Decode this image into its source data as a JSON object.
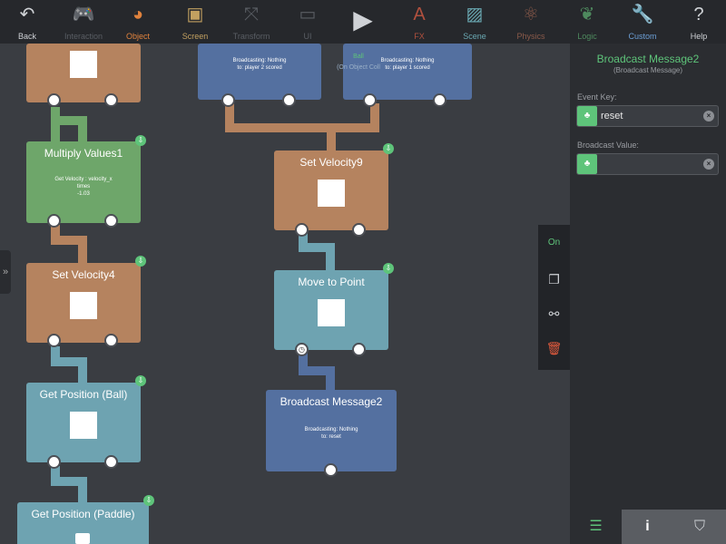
{
  "toolbar": {
    "items": [
      {
        "label": "Back",
        "icon": "back-arrow-icon",
        "glyph": "↶",
        "color": "#cfd2d6"
      },
      {
        "label": "Interaction",
        "icon": "gamepad-icon",
        "glyph": "🎮",
        "color": "#5a5e64"
      },
      {
        "label": "Object",
        "icon": "pacman-icon",
        "glyph": "◕",
        "color": "#e0823d"
      },
      {
        "label": "Screen",
        "icon": "screen-icon",
        "glyph": "▣",
        "color": "#c2a060"
      },
      {
        "label": "Transform",
        "icon": "transform-arrows-icon",
        "glyph": "⤧",
        "color": "#5a5e64"
      },
      {
        "label": "UI",
        "icon": "speech-bubble-icon",
        "glyph": "▭",
        "color": "#5a5e64"
      },
      {
        "label": "",
        "icon": "play-icon",
        "glyph": "▶",
        "color": "#cfd2d6"
      },
      {
        "label": "FX",
        "icon": "fx-icon",
        "glyph": "A",
        "color": "#b0503e"
      },
      {
        "label": "Scene",
        "icon": "scene-image-icon",
        "glyph": "▨",
        "color": "#6aa8b2"
      },
      {
        "label": "Physics",
        "icon": "atom-icon",
        "glyph": "⚛",
        "color": "#8b5a4a"
      },
      {
        "label": "Logic",
        "icon": "brain-icon",
        "glyph": "❦",
        "color": "#4e8a5e"
      },
      {
        "label": "Custom",
        "icon": "wrench-icon",
        "glyph": "🔧",
        "color": "#6c9fd6"
      },
      {
        "label": "Help",
        "icon": "help-icon",
        "glyph": "?",
        "color": "#cfd2d6"
      }
    ]
  },
  "nodes": {
    "top_left": {
      "title": ""
    },
    "multiply": {
      "title": "Multiply Values1",
      "body": [
        "Get Velocity : velocity_x",
        "times",
        "-1.03"
      ]
    },
    "set_velocity4": {
      "title": "Set Velocity4"
    },
    "get_position_ball": {
      "title": "Get Position (Ball)"
    },
    "get_position_paddle": {
      "title": "Get Position (Paddle)"
    },
    "broadcast_a": {
      "body": [
        "Broadcasting: Nothing",
        "to: player 2 scored"
      ]
    },
    "broadcast_b": {
      "body": [
        "Broadcasting: Nothing",
        "to: player 1 scored"
      ]
    },
    "overlay_ball": {
      "title": "Ball",
      "sub": "(On Object Coll"
    },
    "set_velocity9": {
      "title": "Set Velocity9"
    },
    "move_to_point": {
      "title": "Move to Point"
    },
    "broadcast_message2": {
      "title": "Broadcast Message2",
      "body": [
        "Broadcasting: Nothing",
        "to: reset"
      ]
    }
  },
  "float_menu": {
    "on_label": "On",
    "icons": [
      "copy-icon",
      "disconnect-icon",
      "trash-icon"
    ]
  },
  "panel": {
    "title": "Broadcast Message2",
    "subtitle": "(Broadcast Message)",
    "event_key_label": "Event Key:",
    "event_key_value": "reset",
    "broadcast_value_label": "Broadcast Value:",
    "broadcast_value": ""
  },
  "bottom_tabs": [
    "sliders-icon",
    "info-icon",
    "tags-icon"
  ],
  "colors": {
    "accent": "#5ec47a",
    "node_orange": "#b5835f",
    "node_green": "#6ea66a",
    "node_teal": "#6ea3b1",
    "node_blue": "#5470a0"
  }
}
